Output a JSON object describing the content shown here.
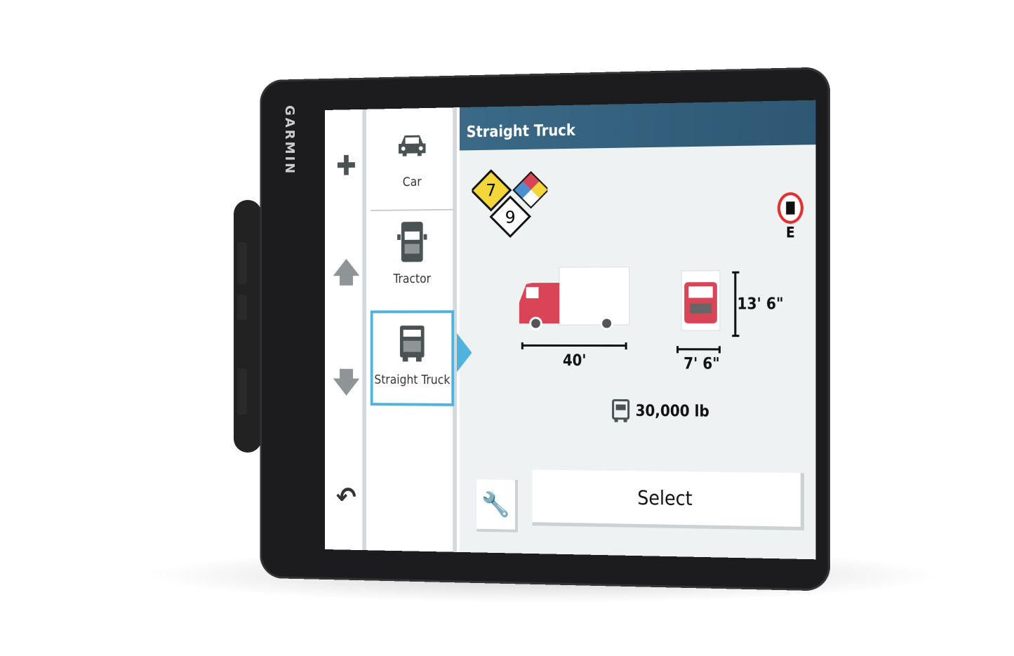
{
  "brand": "GARMIN",
  "nav": {
    "icons": [
      "plus-icon",
      "arrow-up-icon",
      "arrow-down-icon",
      "back-icon"
    ]
  },
  "vehicles": [
    {
      "label": "Car",
      "icon": "car-icon",
      "selected": false
    },
    {
      "label": "Tractor",
      "icon": "tractor-icon",
      "selected": false
    },
    {
      "label": "Straight Truck",
      "icon": "straight-truck-icon",
      "selected": true
    }
  ],
  "detail": {
    "title": "Straight Truck",
    "hazmat": {
      "class_a": "7",
      "class_b": "9"
    },
    "restriction_sign_label": "E",
    "length": "40'",
    "width": "7' 6\"",
    "height": "13' 6\"",
    "weight": "30,000 lb",
    "select_label": "Select"
  },
  "colors": {
    "accent": "#4fb3dd",
    "header": "#2e5773",
    "truck": "#d94456"
  }
}
